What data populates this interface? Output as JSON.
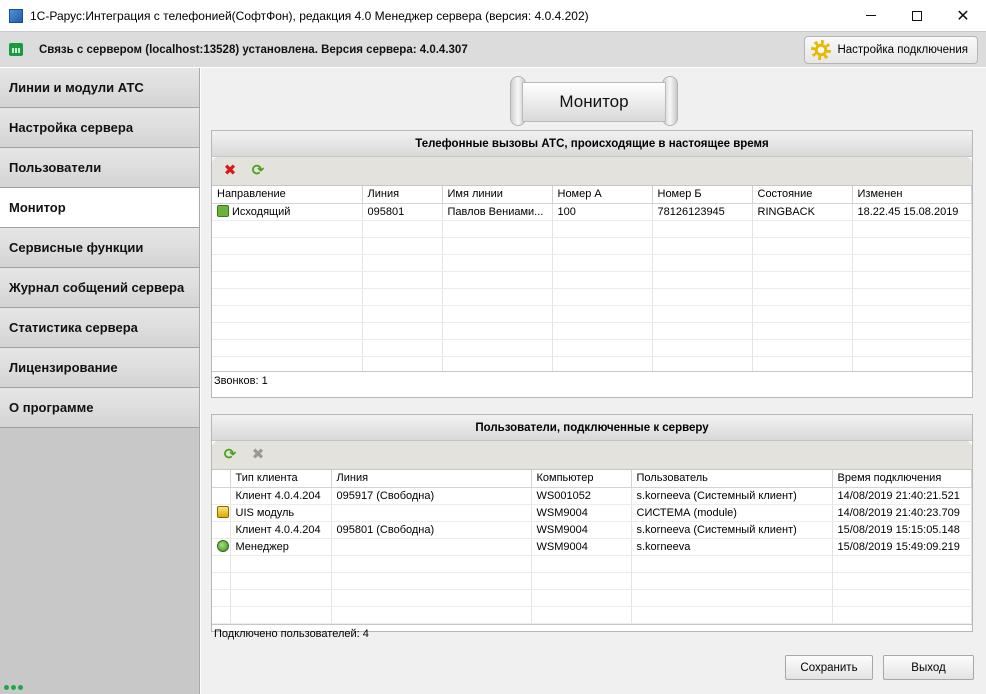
{
  "window": {
    "title": "1С-Рарус:Интеграция с телефонией(СофтФон), редакция 4.0 Менеджер сервера (версия: 4.0.4.202)",
    "controls": [
      "minimize",
      "maximize",
      "close"
    ]
  },
  "status": {
    "text": "Связь с сервером (localhost:13528) установлена. Версия сервера: 4.0.4.307",
    "connection_button": "Настройка подключения"
  },
  "sidebar": {
    "items": [
      {
        "label": "Линии и модули АТС",
        "active": false
      },
      {
        "label": "Настройка сервера",
        "active": false
      },
      {
        "label": "Пользователи",
        "active": false
      },
      {
        "label": "Монитор",
        "active": true
      },
      {
        "label": "Сервисные функции",
        "active": false
      },
      {
        "label": "Журнал собщений сервера",
        "active": false
      },
      {
        "label": "Статистика сервера",
        "active": false
      },
      {
        "label": "Лицензирование",
        "active": false
      },
      {
        "label": "О программе",
        "active": false
      }
    ]
  },
  "main": {
    "banner": "Монитор",
    "calls": {
      "title": "Телефонные вызовы АТС, происходящие в настоящее время",
      "columns": [
        "Направление",
        "Линия",
        "Имя линии",
        "Номер А",
        "Номер Б",
        "Состояние",
        "Изменен"
      ],
      "rows": [
        [
          "Исходящий",
          "095801",
          "Павлов Вениами...",
          "100",
          "78126123945",
          "RINGBACK",
          "18.22.45 15.08.2019"
        ]
      ],
      "footer": "Звонков: 1"
    },
    "users": {
      "title": "Пользователи, подключенные к серверу",
      "columns": [
        "",
        "Тип клиента",
        "Линия",
        "Компьютер",
        "Пользователь",
        "Время подключения"
      ],
      "rows": [
        {
          "icon": "",
          "cells": [
            "Клиент 4.0.4.204",
            "095917 (Свободна)",
            "WS001052",
            "s.korneeva (Системный клиент)",
            "14/08/2019 21:40:21.521"
          ]
        },
        {
          "icon": "module-icon",
          "cells": [
            "UIS модуль",
            "",
            "WSM9004",
            "СИСТЕМА (module)",
            "14/08/2019 21:40:23.709"
          ]
        },
        {
          "icon": "",
          "cells": [
            "Клиент 4.0.4.204",
            "095801 (Свободна)",
            "WSM9004",
            "s.korneeva (Системный клиент)",
            "15/08/2019 15:15:05.148"
          ]
        },
        {
          "icon": "manager-icon",
          "cells": [
            "Менеджер",
            "",
            "WSM9004",
            "s.korneeva",
            "15/08/2019 15:49:09.219"
          ]
        }
      ],
      "footer": "Подключено пользователей: 4"
    },
    "buttons": {
      "save": "Сохранить",
      "exit": "Выход"
    }
  }
}
